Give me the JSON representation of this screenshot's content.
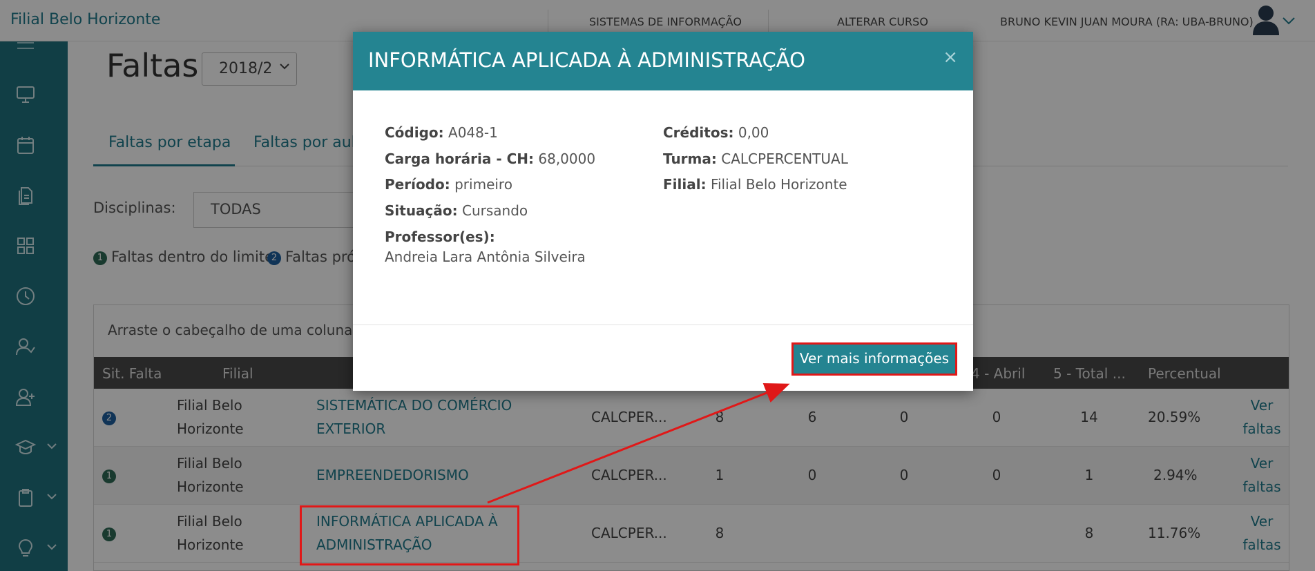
{
  "topbar": {
    "brand": "Filial Belo Horizonte",
    "nav_sistemas": "SISTEMAS DE INFORMAÇÃO",
    "nav_alterar": "ALTERAR CURSO",
    "user": "BRUNO KEVIN JUAN MOURA (RA: UBA-BRUNO)"
  },
  "sidebar": {
    "items": [
      "menu-icon",
      "monitor-icon",
      "calendar-icon",
      "documents-icon",
      "grid-icon",
      "clock-icon",
      "user-check-icon",
      "user-add-icon",
      "graduation-cap-icon",
      "clipboard-icon",
      "lightbulb-icon"
    ]
  },
  "page": {
    "title": "Faltas:",
    "semester": "2018/2",
    "tab1": "Faltas por etapa",
    "tab2": "Faltas por aula",
    "disc_label": "Disciplinas:",
    "disc_value": "TODAS",
    "legend1_num": "1",
    "legend1": "Faltas dentro do limite",
    "legend2_num": "2",
    "legend2": "Faltas pró",
    "grid_hint": "Arraste o cabeçalho de uma coluna e s"
  },
  "grid": {
    "headers": {
      "sit": "Sit. Falta",
      "filial": "Filial",
      "abril": "4 - Abril",
      "total": "5 - Total ...",
      "percentual": "Percentual"
    },
    "rows": [
      {
        "badge": "2",
        "filial1": "Filial Belo",
        "filial2": "Horizonte",
        "disc1": "SISTEMÁTICA DO COMÉRCIO",
        "disc2": "EXTERIOR",
        "turma": "CALCPER...",
        "c1": "8",
        "c2": "6",
        "c3": "0",
        "c4": "0",
        "total": "14",
        "pct": "20.59%",
        "vf1": "Ver",
        "vf2": "faltas"
      },
      {
        "badge": "1",
        "filial1": "Filial Belo",
        "filial2": "Horizonte",
        "disc1": "EMPREENDEDORISMO",
        "disc2": "",
        "turma": "CALCPER...",
        "c1": "1",
        "c2": "0",
        "c3": "0",
        "c4": "0",
        "total": "1",
        "pct": "2.94%",
        "vf1": "Ver",
        "vf2": "faltas"
      },
      {
        "badge": "1",
        "filial1": "Filial Belo",
        "filial2": "Horizonte",
        "disc1": "INFORMÁTICA APLICADA À",
        "disc2": "ADMINISTRAÇÃO",
        "turma": "CALCPER...",
        "c1": "8",
        "c2": "",
        "c3": "",
        "c4": "",
        "total": "8",
        "pct": "11.76%",
        "vf1": "Ver",
        "vf2": "faltas"
      }
    ]
  },
  "modal": {
    "title": "INFORMÁTICA APLICADA À ADMINISTRAÇÃO",
    "close": "×",
    "codigo_label": "Código:",
    "codigo": "A048-1",
    "ch_label": "Carga horária - CH:",
    "ch": "68,0000",
    "periodo_label": "Período:",
    "periodo": "primeiro",
    "situacao_label": "Situação:",
    "situacao": "Cursando",
    "professor_label": "Professor(es):",
    "professor": "Andreia Lara Antônia Silveira",
    "creditos_label": "Créditos:",
    "creditos": "0,00",
    "turma_label": "Turma:",
    "turma": "CALCPERCENTUAL",
    "filial_label": "Filial:",
    "filial": "Filial Belo Horizonte",
    "button": "Ver mais informações"
  },
  "colors": {
    "primary": "#248491",
    "sidebar": "#20727f",
    "highlight": "#e01818"
  }
}
